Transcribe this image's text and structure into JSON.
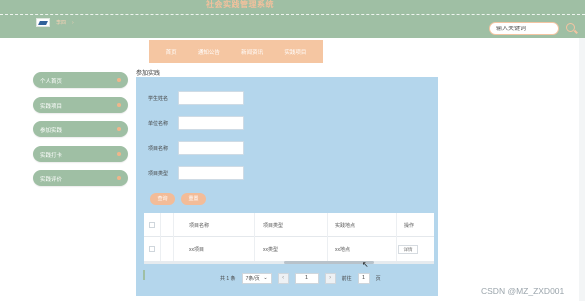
{
  "header": {
    "site_title": "社会实践管理系统",
    "user_name": "李四",
    "user_menu_icon": "chevron-icon",
    "search_placeholder": "输入关键词"
  },
  "nav": {
    "items": [
      {
        "label": "首页"
      },
      {
        "label": "通知公告"
      },
      {
        "label": "新闻资讯"
      },
      {
        "label": "实践项目"
      }
    ]
  },
  "sidebar": {
    "items": [
      {
        "label": "个人首页"
      },
      {
        "label": "实践项目"
      },
      {
        "label": "参加实践"
      },
      {
        "label": "实践打卡"
      },
      {
        "label": "实践评价"
      }
    ]
  },
  "content": {
    "title": "参加实践",
    "form": {
      "fields": [
        {
          "label": "学生姓名",
          "value": ""
        },
        {
          "label": "单位名称",
          "value": ""
        },
        {
          "label": "项目名称",
          "value": ""
        },
        {
          "label": "项目类型",
          "value": ""
        }
      ],
      "search_button": "查询",
      "reset_button": "重置"
    },
    "table": {
      "columns": [
        "项目名称",
        "项目类型",
        "实践地点",
        "操作"
      ],
      "rows": [
        {
          "name": "xx项目",
          "type": "xx类型",
          "place": "xx地点",
          "action": "详情"
        }
      ]
    },
    "pagination": {
      "total_text": "共 1 条",
      "page_size": "7条/页",
      "prev": "‹",
      "current": "1",
      "next": "›",
      "goto_label": "前往",
      "goto_value": "1",
      "page_suffix": "页"
    }
  },
  "watermark": "CSDN @MZ_ZXD001",
  "colors": {
    "header_green": "#9fbfa4",
    "accent_peach": "#f5c6a2",
    "panel_blue": "#b4d6ec"
  }
}
